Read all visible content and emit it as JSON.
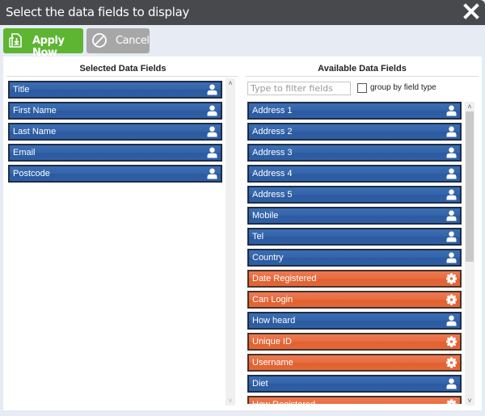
{
  "dialog": {
    "title": "Select the data fields to display",
    "close_icon": "close-x-icon"
  },
  "toolbar": {
    "apply_label": "Apply Now",
    "apply_icon": "download-save-icon",
    "cancel_label": "Cancel",
    "cancel_icon": "prohibited-circle-icon"
  },
  "colors": {
    "titlebar": "#47494c",
    "apply": "#5db532",
    "cancel": "#a7a7a7",
    "user_field": "#3566ab",
    "system_field": "#e96e44"
  },
  "selected": {
    "header": "Selected Data Fields",
    "fields": [
      {
        "label": "Title",
        "type": "user",
        "icon": "person-icon"
      },
      {
        "label": "First Name",
        "type": "user",
        "icon": "person-icon"
      },
      {
        "label": "Last Name",
        "type": "user",
        "icon": "person-icon"
      },
      {
        "label": "Email",
        "type": "user",
        "icon": "person-icon"
      },
      {
        "label": "Postcode",
        "type": "user",
        "icon": "person-icon"
      }
    ]
  },
  "available": {
    "header": "Available Data Fields",
    "filter_placeholder": "Type to filter fields",
    "filter_value": "",
    "group_label": "group by field type",
    "group_checked": false,
    "fields": [
      {
        "label": "Address 1",
        "type": "user",
        "icon": "person-icon"
      },
      {
        "label": "Address 2",
        "type": "user",
        "icon": "person-icon"
      },
      {
        "label": "Address 3",
        "type": "user",
        "icon": "person-icon"
      },
      {
        "label": "Address 4",
        "type": "user",
        "icon": "person-icon"
      },
      {
        "label": "Address 5",
        "type": "user",
        "icon": "person-icon"
      },
      {
        "label": "Mobile",
        "type": "user",
        "icon": "person-icon"
      },
      {
        "label": "Tel",
        "type": "user",
        "icon": "person-icon"
      },
      {
        "label": "Country",
        "type": "user",
        "icon": "person-icon"
      },
      {
        "label": "Date Registered",
        "type": "system",
        "icon": "gear-icon"
      },
      {
        "label": "Can Login",
        "type": "system",
        "icon": "gear-icon"
      },
      {
        "label": "How heard",
        "type": "user",
        "icon": "person-icon"
      },
      {
        "label": "Unique ID",
        "type": "system",
        "icon": "gear-icon"
      },
      {
        "label": "Username",
        "type": "system",
        "icon": "gear-icon"
      },
      {
        "label": "Diet",
        "type": "user",
        "icon": "person-icon"
      },
      {
        "label": "How Registered",
        "type": "system",
        "icon": "gear-icon"
      }
    ]
  }
}
